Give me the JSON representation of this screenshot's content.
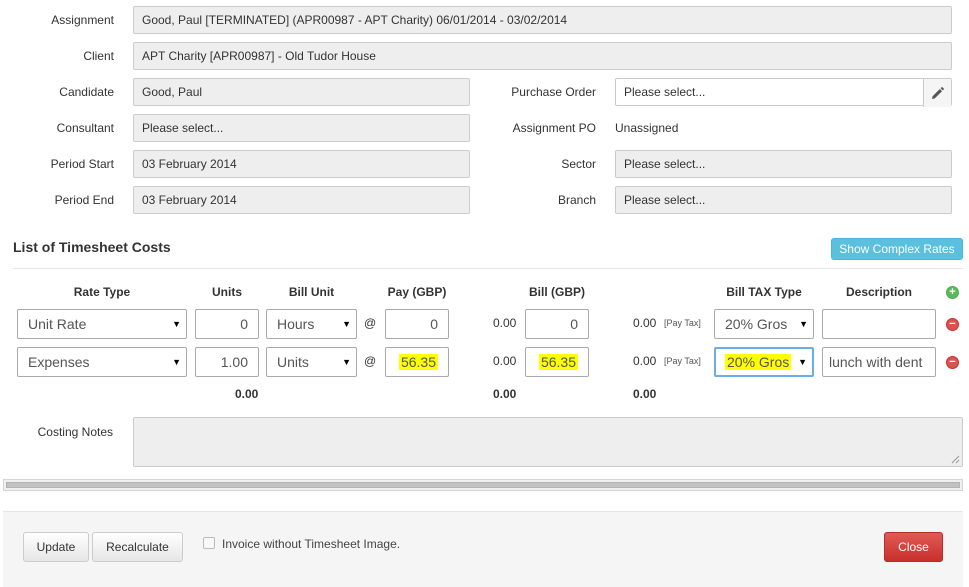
{
  "assignment": {
    "label": "Assignment",
    "value": "Good, Paul [TERMINATED] (APR00987 - APT Charity) 06/01/2014 - 03/02/2014"
  },
  "client": {
    "label": "Client",
    "value": "APT Charity [APR00987] - Old Tudor House"
  },
  "candidate": {
    "label": "Candidate",
    "value": "Good, Paul"
  },
  "consultant": {
    "label": "Consultant",
    "value": "Please select..."
  },
  "period_start": {
    "label": "Period Start",
    "value": "03 February 2014"
  },
  "period_end": {
    "label": "Period End",
    "value": "03 February 2014"
  },
  "purchase_order": {
    "label": "Purchase Order",
    "value": "Please select..."
  },
  "assignment_po": {
    "label": "Assignment PO",
    "value": "Unassigned"
  },
  "sector": {
    "label": "Sector",
    "value": "Please select..."
  },
  "branch": {
    "label": "Branch",
    "value": "Please select..."
  },
  "costs": {
    "title": "List of Timesheet Costs",
    "show_complex_rates": "Show Complex Rates",
    "headers": {
      "rate_type": "Rate Type",
      "units": "Units",
      "bill_unit": "Bill Unit",
      "pay": "Pay (GBP)",
      "bill": "Bill (GBP)",
      "bill_tax_type": "Bill TAX Type",
      "description": "Description"
    },
    "rows": [
      {
        "rate_type": "Unit Rate",
        "units": "0",
        "bill_unit": "Hours",
        "at": "@",
        "pay": "0",
        "pay_calc": "0.00",
        "bill": "0",
        "bill_calc": "0.00",
        "pay_tax": "[Pay Tax]",
        "bill_tax_type": "20% Gros",
        "description": ""
      },
      {
        "rate_type": "Expenses",
        "units": "1.00",
        "bill_unit": "Units",
        "at": "@",
        "pay": "56.35",
        "pay_calc": "0.00",
        "bill": "56.35",
        "bill_calc": "0.00",
        "pay_tax": "[Pay Tax]",
        "bill_tax_type": "20% Gros",
        "description": "lunch with dent"
      }
    ],
    "totals": {
      "units": "0.00",
      "bill": "0.00",
      "tax": "0.00"
    },
    "notes_label": "Costing Notes",
    "notes_value": ""
  },
  "footer": {
    "update": "Update",
    "recalculate": "Recalculate",
    "invoice_checkbox_label": "Invoice without Timesheet Image.",
    "invoice_checked": false,
    "close": "Close"
  },
  "colors": {
    "highlight": "#ffff00",
    "info_button": "#5bc0de",
    "danger_button": "#d9534f",
    "add_icon": "#5cb85c",
    "remove_icon": "#d9534f"
  }
}
